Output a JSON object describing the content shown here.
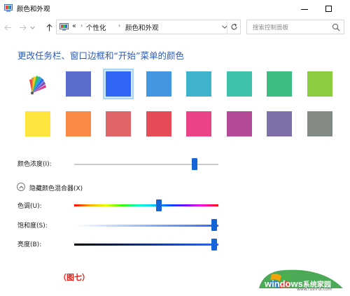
{
  "window": {
    "title": "颜色和外观"
  },
  "address": {
    "overflow": "«",
    "crumbs": [
      "个性化",
      "颜色和外观"
    ],
    "search_placeholder": "搜索控制面板"
  },
  "main": {
    "heading": "更改任务栏、窗口边框和“开始”菜单的颜色",
    "selected_index": 2,
    "swatches_row1": [
      "auto",
      "#5a6ecf",
      "#2f66f5",
      "#4596e2",
      "#3fb3cc",
      "#3ec2a9",
      "#3dbd80",
      "#8ccc3f"
    ],
    "swatches_row2": [
      "#fde53e",
      "#fa8945",
      "#e06367",
      "#e64b58",
      "#ea4387",
      "#b54a99",
      "#7e6fa8",
      "#838a84"
    ],
    "intensity": {
      "label": "颜色浓度(I):",
      "value": 0.86
    },
    "mixer_toggle": "隐藏颜色混合器(X)",
    "hue": {
      "label": "色调(U):",
      "value": 0.6
    },
    "saturation": {
      "label": "饱和度(S):",
      "value": 1.0
    },
    "brightness": {
      "label": "亮度(B):",
      "value": 1.0
    }
  },
  "caption": "（图七）",
  "watermark": {
    "brand": "windows",
    "brand_cn": "系统家园",
    "url": "www.ruinrui.com"
  },
  "colors": {
    "accent": "#2f5ab4",
    "thumb": "#1565d8",
    "selection_border": "#a9d6f5",
    "caption": "#e0201c"
  }
}
